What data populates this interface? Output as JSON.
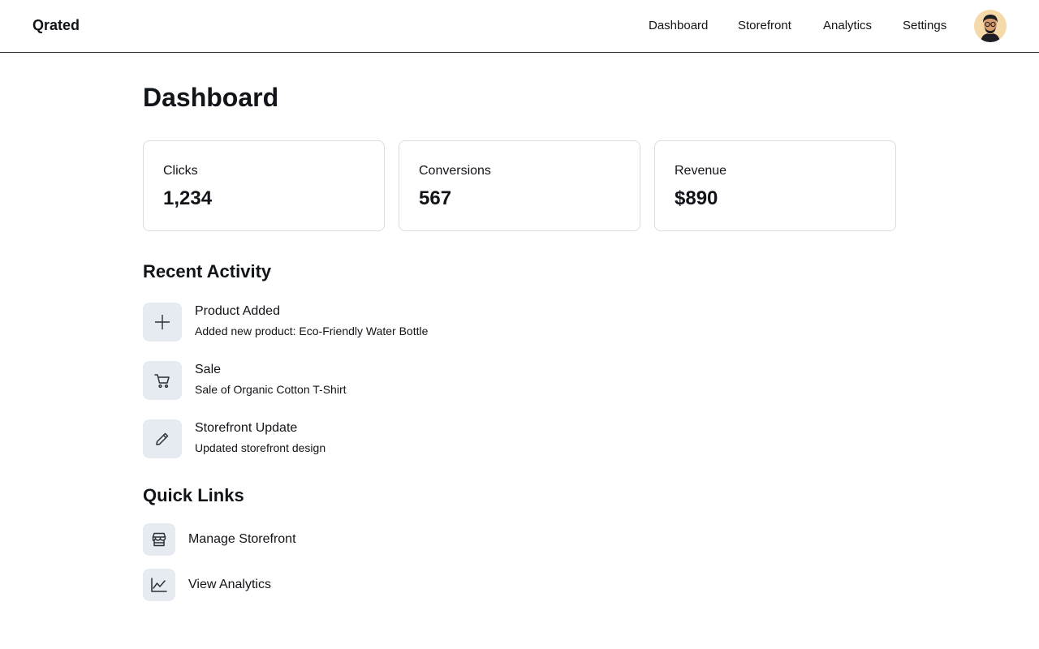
{
  "brand": "Qrated",
  "nav": [
    "Dashboard",
    "Storefront",
    "Analytics",
    "Settings"
  ],
  "page_title": "Dashboard",
  "stats": [
    {
      "label": "Clicks",
      "value": "1,234"
    },
    {
      "label": "Conversions",
      "value": "567"
    },
    {
      "label": "Revenue",
      "value": "$890"
    }
  ],
  "recent_activity": {
    "title": "Recent Activity",
    "items": [
      {
        "title": "Product Added",
        "subtitle": "Added new product: Eco-Friendly Water Bottle",
        "icon": "plus-icon"
      },
      {
        "title": "Sale",
        "subtitle": "Sale of Organic Cotton T-Shirt",
        "icon": "cart-icon"
      },
      {
        "title": "Storefront Update",
        "subtitle": "Updated storefront design",
        "icon": "pencil-icon"
      }
    ]
  },
  "quick_links": {
    "title": "Quick Links",
    "items": [
      {
        "label": "Manage Storefront",
        "icon": "storefront-icon"
      },
      {
        "label": "View Analytics",
        "icon": "chart-line-icon"
      }
    ]
  },
  "colors": {
    "text": "#111418",
    "card_border": "#d9dde3",
    "icon_bg": "#e6eaf1",
    "avatar_bg": "#f5d9a8"
  }
}
